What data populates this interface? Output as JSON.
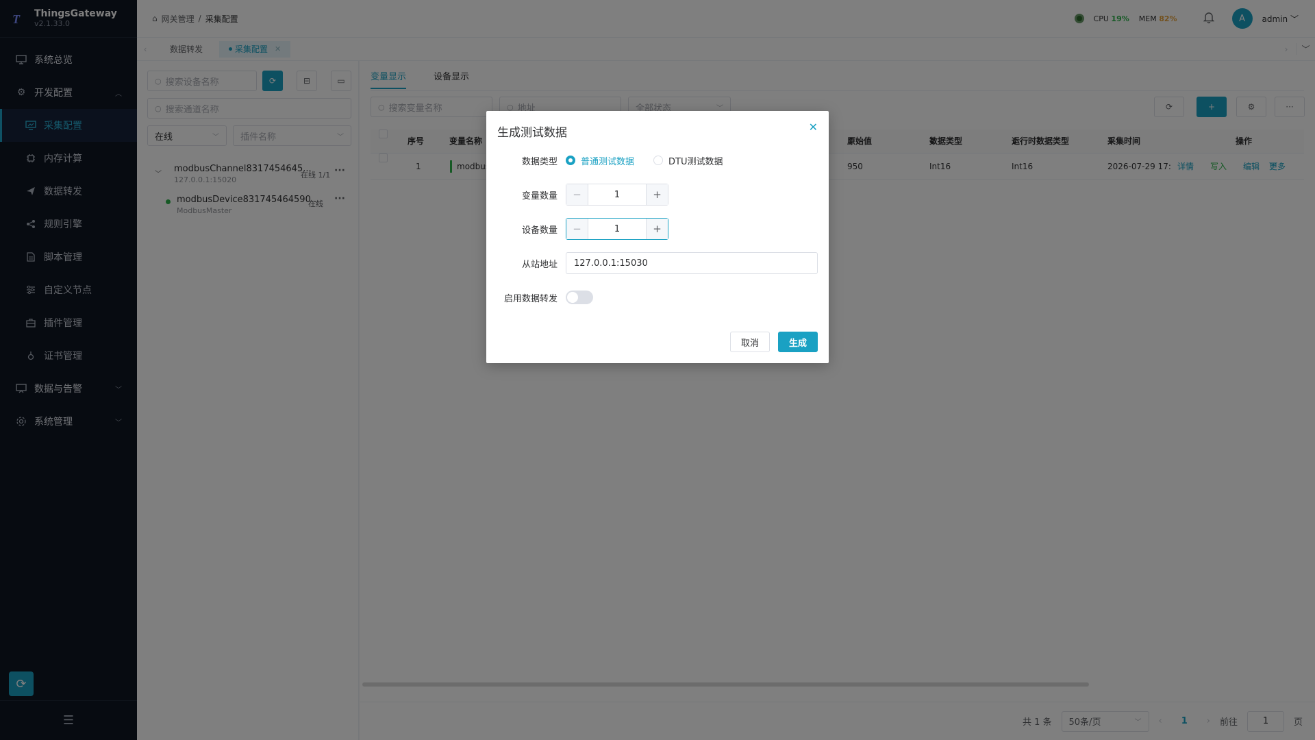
{
  "app": {
    "name": "ThingsGateway",
    "version": "v2.1.33.0"
  },
  "sidebar": {
    "items": [
      {
        "label": "系统总览",
        "icon": "monitor-icon"
      },
      {
        "label": "开发配置",
        "icon": "gear-icon"
      },
      {
        "label": "采集配置",
        "icon": "chart-monitor-icon"
      },
      {
        "label": "内存计算",
        "icon": "chip-icon"
      },
      {
        "label": "数据转发",
        "icon": "send-icon"
      },
      {
        "label": "规则引擎",
        "icon": "share-icon"
      },
      {
        "label": "脚本管理",
        "icon": "document-icon"
      },
      {
        "label": "自定义节点",
        "icon": "sliders-icon"
      },
      {
        "label": "插件管理",
        "icon": "briefcase-icon"
      },
      {
        "label": "证书管理",
        "icon": "certificate-icon"
      },
      {
        "label": "数据与告警",
        "icon": "alarm-board-icon"
      },
      {
        "label": "系统管理",
        "icon": "settings-icon"
      }
    ]
  },
  "header": {
    "breadcrumb": [
      "网关管理",
      "采集配置"
    ],
    "cpu_label": "CPU",
    "cpu_value": "19%",
    "mem_label": "MEM",
    "mem_value": "82%",
    "avatar_letter": "A",
    "user": "admin"
  },
  "page_tabs": [
    {
      "label": "数据转发"
    },
    {
      "label": "采集配置"
    }
  ],
  "left": {
    "search_device_placeholder": "搜索设备名称",
    "search_channel_placeholder": "搜索通道名称",
    "status_select": "在线",
    "plugin_placeholder": "插件名称",
    "tree": {
      "channel_name": "modbusChannel8317454645...",
      "channel_addr": "127.0.0.1:15020",
      "channel_status": "在线 1/1",
      "device_name": "modbusDevice831745464590...",
      "device_plugin": "ModbusMaster",
      "device_status": "在线"
    }
  },
  "main": {
    "tabs": [
      "变量显示",
      "设备显示"
    ],
    "filter_name_placeholder": "搜索变量名称",
    "filter_addr_placeholder": "地址",
    "filter_status": "全部状态",
    "columns": [
      "序号",
      "变量名称",
      "原始值",
      "数据类型",
      "运行时数据类型",
      "采集时间",
      "操作"
    ],
    "row": {
      "index": "1",
      "name": "modbus",
      "raw": "950",
      "dtype": "Int16",
      "rtype": "Int16",
      "time": "2026-07-29 17:",
      "ops": [
        "详情",
        "写入",
        "编辑",
        "更多"
      ]
    },
    "pager": {
      "total": "共 1 条",
      "page_size": "50条/页",
      "current": "1",
      "goto_label": "前往",
      "goto_value": "1",
      "page_unit": "页"
    }
  },
  "dialog": {
    "title": "生成测试数据",
    "data_type_label": "数据类型",
    "radio_normal": "普通测试数据",
    "radio_dtu": "DTU测试数据",
    "var_count_label": "变量数量",
    "var_count": "1",
    "dev_count_label": "设备数量",
    "dev_count": "1",
    "slave_addr_label": "从站地址",
    "slave_addr": "127.0.0.1:15030",
    "forward_label": "启用数据转发",
    "cancel": "取消",
    "generate": "生成"
  },
  "colors": {
    "accent": "#1aa1c3",
    "sidebar_bg": "#0f1623",
    "cpu_ok": "#2cb34a",
    "mem_warn": "#e6a23c"
  }
}
